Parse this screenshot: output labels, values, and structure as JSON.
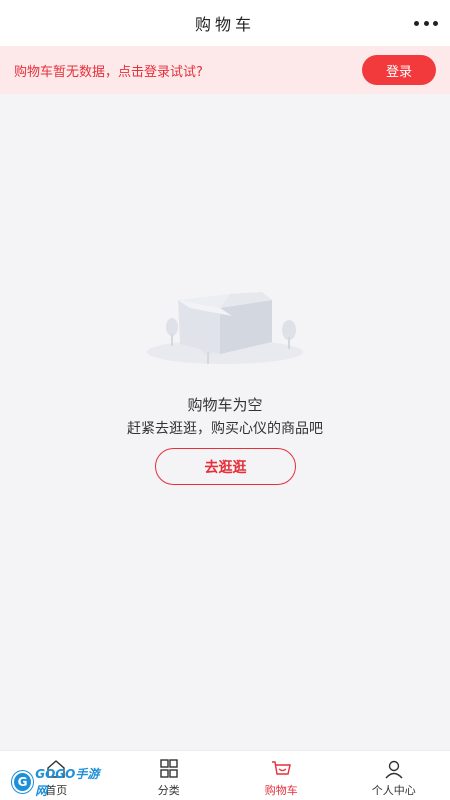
{
  "header": {
    "title": "购物车"
  },
  "banner": {
    "message": "购物车暂无数据，点击登录试试?",
    "login_label": "登录"
  },
  "empty": {
    "title": "购物车为空",
    "subtitle": "赶紧去逛逛，购买心仪的商品吧",
    "button_label": "去逛逛"
  },
  "tabs": [
    {
      "label": "首页",
      "icon": "home-icon"
    },
    {
      "label": "分类",
      "icon": "grid-icon"
    },
    {
      "label": "购物车",
      "icon": "cart-icon",
      "active": true
    },
    {
      "label": "个人中心",
      "icon": "user-icon"
    }
  ],
  "watermark": {
    "text": "GOGO手游网",
    "logo_text": "G"
  },
  "colors": {
    "accent": "#e5303a",
    "banner_bg": "#fde9ea",
    "page_bg": "#f4f4f6"
  }
}
